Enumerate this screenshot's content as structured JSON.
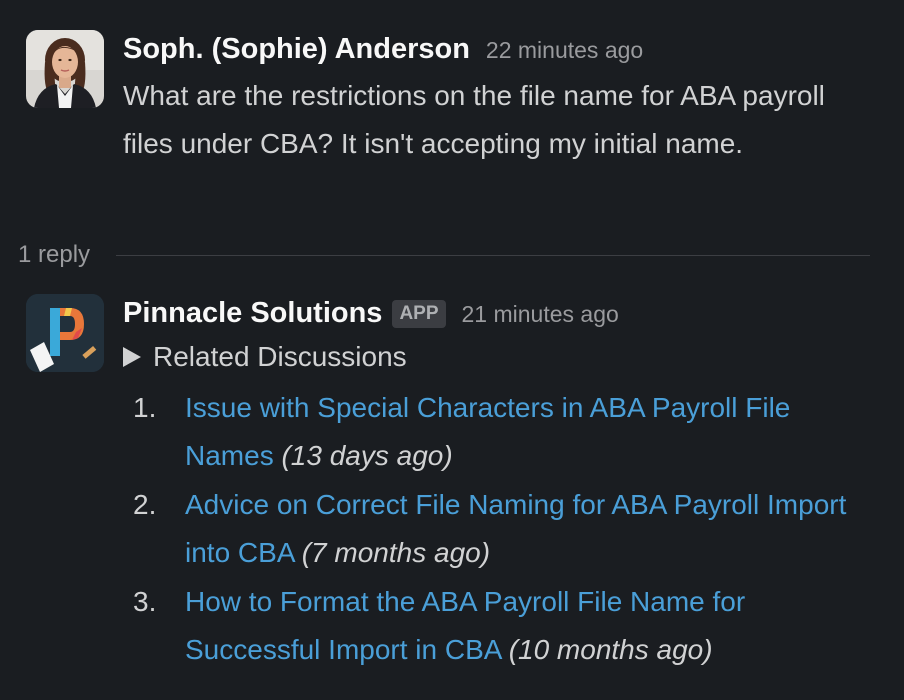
{
  "messages": [
    {
      "author": "Soph. (Sophie) Anderson",
      "time": "22 minutes ago",
      "text": "What are the restrictions on the file name for ABA payroll files under CBA? It isn't accepting my initial name."
    },
    {
      "author": "Pinnacle Solutions",
      "badge": "APP",
      "time": "21 minutes ago",
      "details_summary": "Related Discussions",
      "discussions": [
        {
          "number": "1.",
          "title": "Issue with Special Characters in ABA Payroll File Names",
          "age": "(13 days ago)"
        },
        {
          "number": "2.",
          "title": "Advice on Correct File Naming for ABA Payroll Import into CBA",
          "age": "(7 months ago)"
        },
        {
          "number": "3.",
          "title": "How to Format the ABA Payroll File Name for Successful Import in CBA",
          "age": "(10 months ago)"
        }
      ]
    }
  ],
  "thread": {
    "reply_count": "1 reply"
  },
  "colors": {
    "background": "#1a1d21",
    "link": "#4a9fd8",
    "muted": "#9a9b9e",
    "text": "#d1d2d3"
  },
  "icons": {
    "avatar_user": "user-photo-avatar",
    "avatar_app": "pinnacle-p-logo",
    "expand": "triangle-right-icon"
  }
}
